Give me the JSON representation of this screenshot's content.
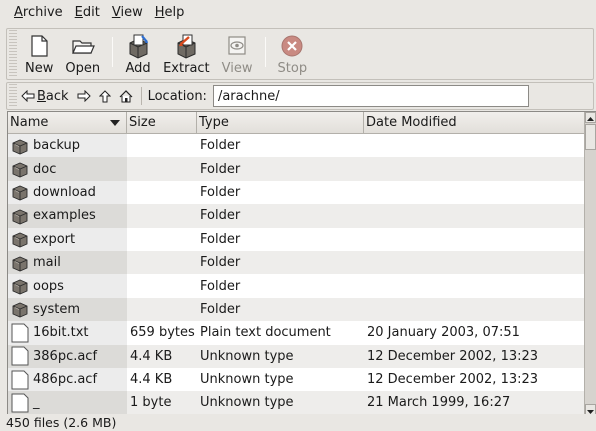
{
  "menu": [
    {
      "pre": "",
      "ul": "A",
      "post": "rchive"
    },
    {
      "pre": "",
      "ul": "E",
      "post": "dit"
    },
    {
      "pre": "",
      "ul": "V",
      "post": "iew"
    },
    {
      "pre": "",
      "ul": "H",
      "post": "elp"
    }
  ],
  "toolbar": {
    "new_label": "New",
    "open_label": "Open",
    "add_label": "Add",
    "extract_label": "Extract",
    "view_label": "View",
    "stop_label": "Stop"
  },
  "location": {
    "back_pre": "",
    "back_ul": "B",
    "back_post": "ack",
    "label": "Location:",
    "value": "/arachne/"
  },
  "columns": {
    "name": "Name",
    "size": "Size",
    "type": "Type",
    "date": "Date Modified"
  },
  "rows": [
    {
      "name": "backup",
      "size": "",
      "type": "Folder",
      "date": "",
      "kind": "folder-icon"
    },
    {
      "name": "doc",
      "size": "",
      "type": "Folder",
      "date": "",
      "kind": "folder-icon"
    },
    {
      "name": "download",
      "size": "",
      "type": "Folder",
      "date": "",
      "kind": "folder-icon"
    },
    {
      "name": "examples",
      "size": "",
      "type": "Folder",
      "date": "",
      "kind": "folder-icon"
    },
    {
      "name": "export",
      "size": "",
      "type": "Folder",
      "date": "",
      "kind": "folder-icon"
    },
    {
      "name": "mail",
      "size": "",
      "type": "Folder",
      "date": "",
      "kind": "folder-icon"
    },
    {
      "name": "oops",
      "size": "",
      "type": "Folder",
      "date": "",
      "kind": "folder-icon"
    },
    {
      "name": "system",
      "size": "",
      "type": "Folder",
      "date": "",
      "kind": "folder-icon"
    },
    {
      "name": "16bit.txt",
      "size": "659 bytes",
      "type": "Plain text document",
      "date": "20 January 2003, 07:51",
      "kind": "file-icon"
    },
    {
      "name": "386pc.acf",
      "size": "4.4 KB",
      "type": "Unknown type",
      "date": "12 December 2002, 13:23",
      "kind": "file-icon"
    },
    {
      "name": "486pc.acf",
      "size": "4.4 KB",
      "type": "Unknown type",
      "date": "12 December 2002, 13:23",
      "kind": "file-icon"
    },
    {
      "name": "_",
      "size": "1 byte",
      "type": "Unknown type",
      "date": "21 March 1999, 16:27",
      "kind": "file-icon"
    }
  ],
  "status": "450 files (2.6 MB)"
}
